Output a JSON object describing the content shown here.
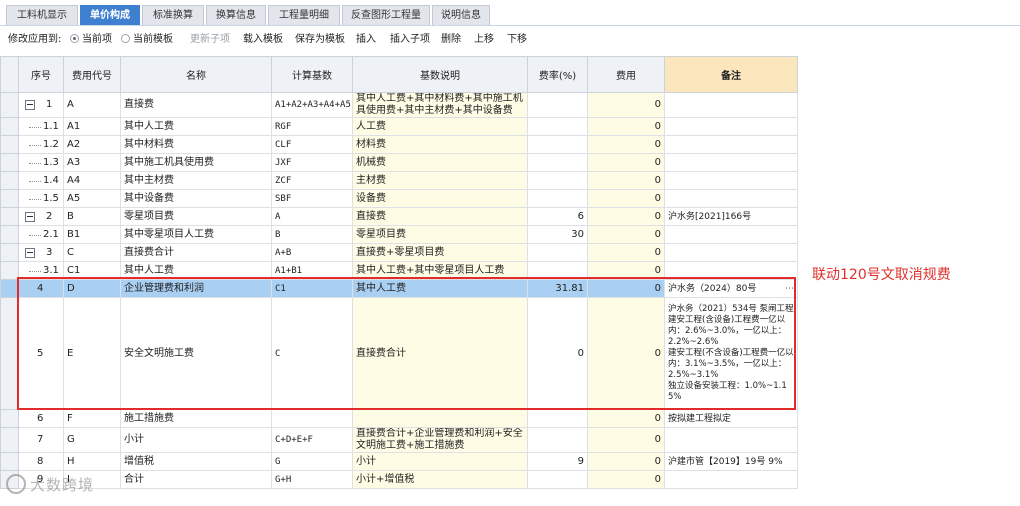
{
  "tabs": [
    {
      "label": "工料机显示",
      "active": false
    },
    {
      "label": "单价构成",
      "active": true
    },
    {
      "label": "标准换算",
      "active": false
    },
    {
      "label": "换算信息",
      "active": false
    },
    {
      "label": "工程量明细",
      "active": false
    },
    {
      "label": "反查图形工程量",
      "active": false
    },
    {
      "label": "说明信息",
      "active": false
    }
  ],
  "toolbar": {
    "apply_to_label": "修改应用到:",
    "current_item": "当前项",
    "current_template": "当前模板",
    "update_sub": "更新子项",
    "load_template": "载入模板",
    "save_template": "保存为模板",
    "insert": "插入",
    "insert_child": "插入子项",
    "delete": "删除",
    "move_up": "上移",
    "move_down": "下移"
  },
  "headers": {
    "seq": "序号",
    "code": "费用代号",
    "name": "名称",
    "base": "计算基数",
    "base_desc": "基数说明",
    "rate": "费率(%)",
    "fee": "费用",
    "note": "备注"
  },
  "rows": [
    {
      "seq": "1",
      "code": "A",
      "name": "直接费",
      "base": "A1+A2+A3+A4+A5",
      "desc": "其中人工费+其中材料费+其中施工机具使用费+其中主材费+其中设备费",
      "rate": "",
      "fee": "0",
      "note": ""
    },
    {
      "seq": "1.1",
      "code": "A1",
      "name": "其中人工费",
      "base": "RGF",
      "desc": "人工费",
      "rate": "",
      "fee": "0",
      "note": ""
    },
    {
      "seq": "1.2",
      "code": "A2",
      "name": "其中材料费",
      "base": "CLF",
      "desc": "材料费",
      "rate": "",
      "fee": "0",
      "note": ""
    },
    {
      "seq": "1.3",
      "code": "A3",
      "name": "其中施工机具使用费",
      "base": "JXF",
      "desc": "机械费",
      "rate": "",
      "fee": "0",
      "note": ""
    },
    {
      "seq": "1.4",
      "code": "A4",
      "name": "其中主材费",
      "base": "ZCF",
      "desc": "主材费",
      "rate": "",
      "fee": "0",
      "note": ""
    },
    {
      "seq": "1.5",
      "code": "A5",
      "name": "其中设备费",
      "base": "SBF",
      "desc": "设备费",
      "rate": "",
      "fee": "0",
      "note": ""
    },
    {
      "seq": "2",
      "code": "B",
      "name": "零星项目费",
      "base": "A",
      "desc": "直接费",
      "rate": "6",
      "fee": "0",
      "note": "沪水务[2021]166号"
    },
    {
      "seq": "2.1",
      "code": "B1",
      "name": "其中零星项目人工费",
      "base": "B",
      "desc": "零星项目费",
      "rate": "30",
      "fee": "0",
      "note": ""
    },
    {
      "seq": "3",
      "code": "C",
      "name": "直接费合计",
      "base": "A+B",
      "desc": "直接费+零星项目费",
      "rate": "",
      "fee": "0",
      "note": ""
    },
    {
      "seq": "3.1",
      "code": "C1",
      "name": "其中人工费",
      "base": "A1+B1",
      "desc": "其中人工费+其中零星项目人工费",
      "rate": "",
      "fee": "0",
      "note": ""
    },
    {
      "seq": "4",
      "code": "D",
      "name": "企业管理费和利润",
      "base": "C1",
      "desc": "其中人工费",
      "rate": "31.81",
      "fee": "0",
      "note": "沪水务（2024）80号"
    },
    {
      "seq": "5",
      "code": "E",
      "name": "安全文明施工费",
      "base": "C",
      "desc": "直接费合计",
      "rate": "0",
      "fee": "0",
      "note": "沪水务（2021）534号 泵闸工程\n建安工程(含设备)工程费一亿以内：2.6%~3.0%，一亿以上：2.2%~2.6%\n建安工程(不含设备)工程费一亿以内：3.1%~3.5%，一亿以上：2.5%~3.1%\n独立设备安装工程：1.0%~1.15%"
    },
    {
      "seq": "6",
      "code": "F",
      "name": "施工措施费",
      "base": "",
      "desc": "",
      "rate": "",
      "fee": "0",
      "note": "按拟建工程拟定"
    },
    {
      "seq": "7",
      "code": "G",
      "name": "小计",
      "base": "C+D+E+F",
      "desc": "直接费合计+企业管理费和利润+安全文明施工费+施工措施费",
      "rate": "",
      "fee": "0",
      "note": ""
    },
    {
      "seq": "8",
      "code": "H",
      "name": "增值税",
      "base": "G",
      "desc": "小计",
      "rate": "9",
      "fee": "0",
      "note": "沪建市管【2019】19号 9%"
    },
    {
      "seq": "9",
      "code": "I",
      "name": "合计",
      "base": "G+H",
      "desc": "小计+增值税",
      "rate": "",
      "fee": "0",
      "note": ""
    }
  ],
  "annotation": "联动120号文取消规费",
  "watermark": "大数跨境",
  "colors": {
    "accent": "#3f7fd0",
    "highlight_box": "#e22b2b",
    "selected_row": "#a9cff3",
    "note_header": "#fbe6bd"
  }
}
